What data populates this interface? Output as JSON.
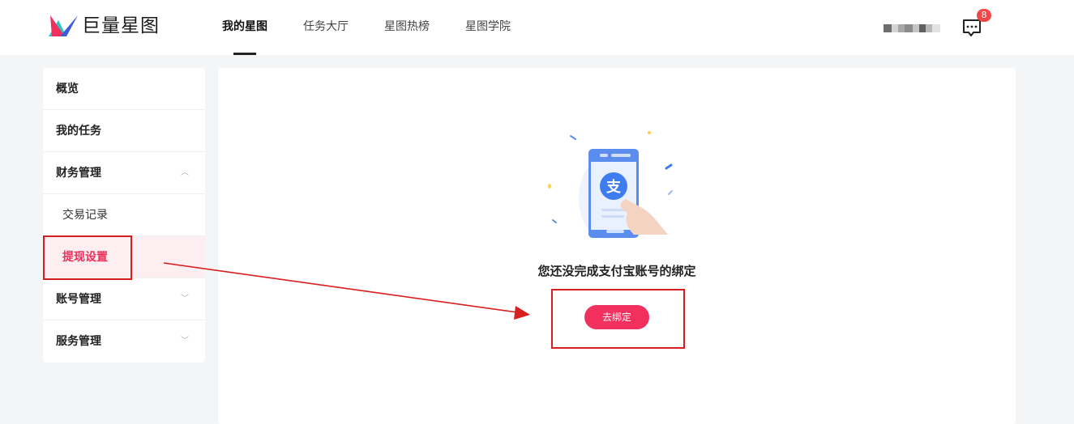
{
  "header": {
    "brand": "巨量星图",
    "nav": [
      "我的星图",
      "任务大厅",
      "星图热榜",
      "星图学院"
    ],
    "message_count": "8"
  },
  "sidebar": {
    "items": [
      {
        "label": "概览"
      },
      {
        "label": "我的任务"
      },
      {
        "label": "财务管理"
      },
      {
        "label": "交易记录"
      },
      {
        "label": "提现设置"
      },
      {
        "label": "账号管理"
      },
      {
        "label": "服务管理"
      }
    ]
  },
  "main": {
    "empty_message": "您还没完成支付宝账号的绑定",
    "bind_button": "去绑定",
    "alipay_glyph": "支"
  },
  "colors": {
    "accent": "#f2305e",
    "annotation": "#d81e1e"
  }
}
